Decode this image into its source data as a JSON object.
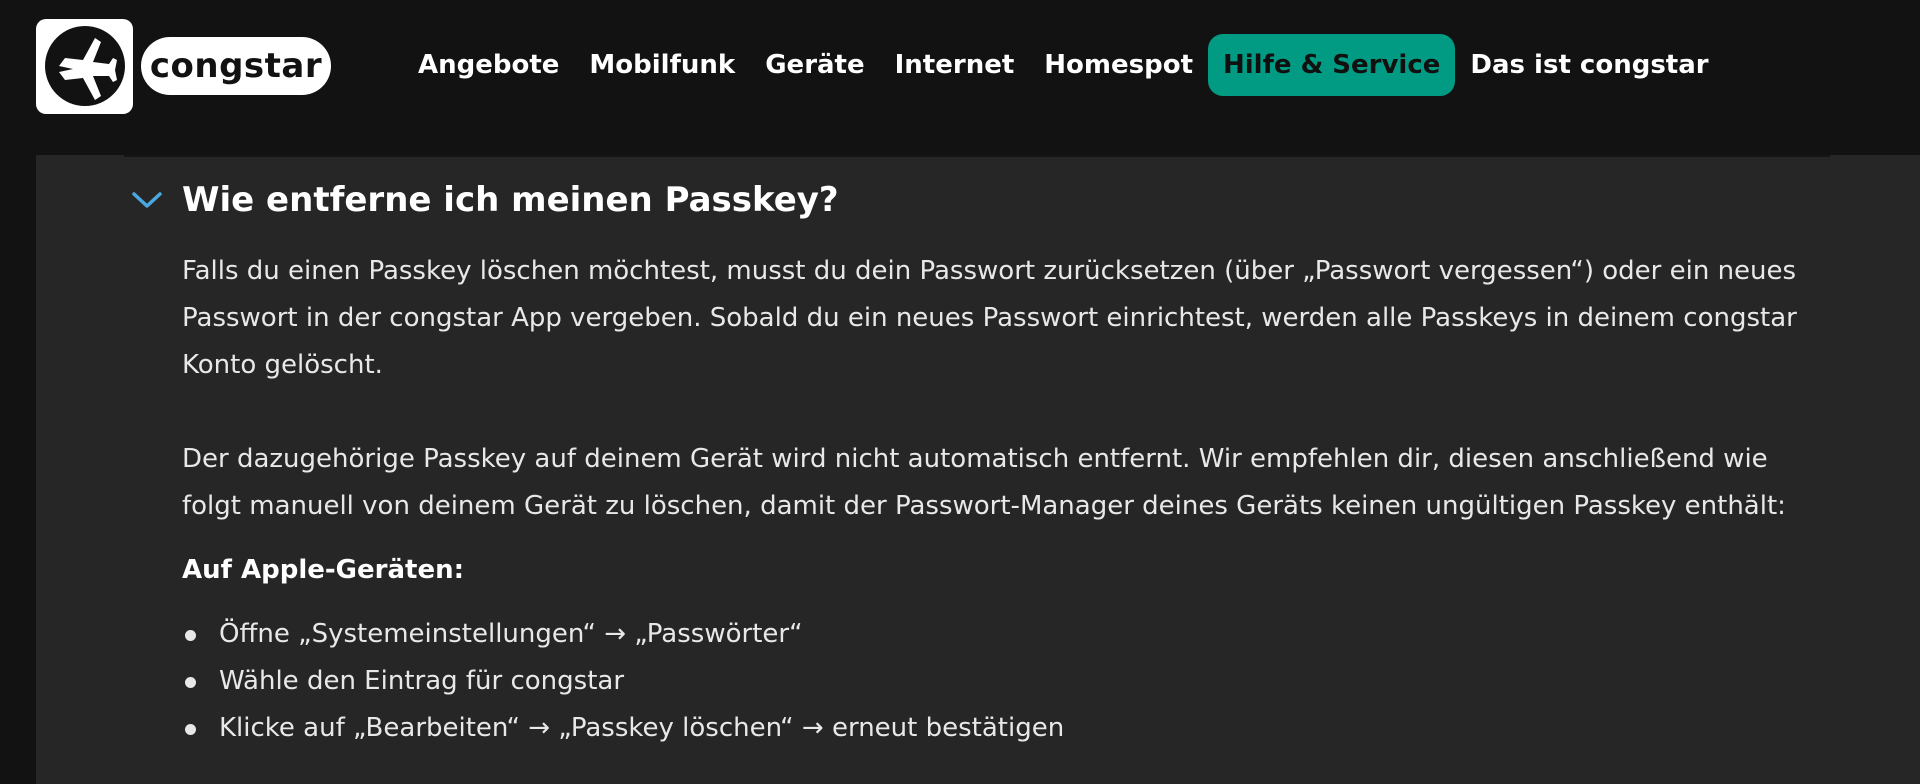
{
  "brand": {
    "name": "congstar"
  },
  "nav": {
    "items": [
      {
        "label": "Angebote"
      },
      {
        "label": "Mobilfunk"
      },
      {
        "label": "Geräte"
      },
      {
        "label": "Internet"
      },
      {
        "label": "Homespot"
      },
      {
        "label": "Hilfe & Service",
        "active": true
      },
      {
        "label": "Das ist congstar"
      }
    ]
  },
  "faq": {
    "question": "Wie entferne ich meinen Passkey?",
    "paragraph1": "Falls du einen Passkey löschen möchtest, musst du dein Passwort zurücksetzen (über „Passwort vergessen“) oder ein neues Passwort in der congstar App vergeben. Sobald du ein neues Passwort einrichtest, werden alle Passkeys in deinem congstar Konto gelöscht.",
    "paragraph2": "Der dazugehörige Passkey auf deinem Gerät wird nicht automatisch entfernt. Wir empfehlen dir, diesen anschließend wie folgt manuell von deinem Gerät zu löschen, damit der Passwort-Manager deines Geräts keinen ungültigen Passkey enthält:",
    "apple_heading": "Auf Apple-Geräten:",
    "apple_steps": [
      "Öffne „Systemeinstellungen“ → „Passwörter“",
      "Wähle den Eintrag für congstar",
      "Klicke auf „Bearbeiten“ → „Passkey löschen“ → erneut bestätigen"
    ]
  },
  "colors": {
    "accent": "#009b82",
    "chevron": "#4aa8e0",
    "background": "#121212",
    "panel": "#262626"
  }
}
